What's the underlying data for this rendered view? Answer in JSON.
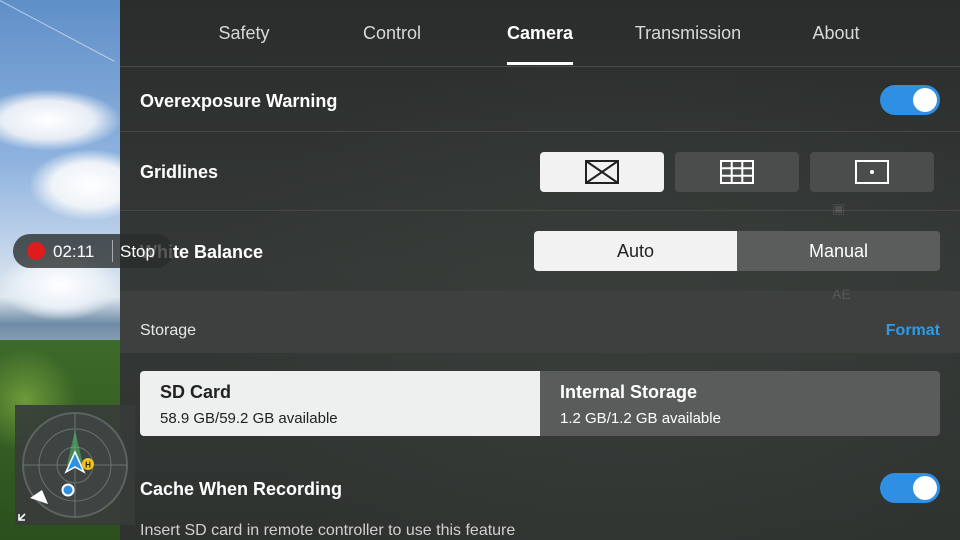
{
  "tabs": [
    {
      "label": "Safety"
    },
    {
      "label": "Control"
    },
    {
      "label": "Camera"
    },
    {
      "label": "Transmission"
    },
    {
      "label": "About"
    }
  ],
  "active_tab": "Camera",
  "settings": {
    "overexposure": {
      "label": "Overexposure Warning",
      "enabled": true
    },
    "gridlines": {
      "label": "Gridlines",
      "options": [
        "diagonal-grid-icon",
        "thirds-grid-icon",
        "center-point-icon"
      ],
      "selected": "diagonal-grid-icon"
    },
    "white_balance": {
      "label": "White Balance",
      "options": [
        "Auto",
        "Manual"
      ],
      "selected": "Auto"
    },
    "cache_recording": {
      "label": "Cache When Recording",
      "enabled": true
    }
  },
  "storage": {
    "section_title": "Storage",
    "format_label": "Format",
    "options": [
      {
        "name": "SD Card",
        "availability": "58.9 GB/59.2 GB available"
      },
      {
        "name": "Internal Storage",
        "availability": "1.2 GB/1.2 GB available"
      }
    ],
    "selected": "SD Card"
  },
  "hint": "Insert SD card in remote controller to use this feature",
  "recording": {
    "time": "02:11",
    "stop_label": "Stop"
  },
  "colors": {
    "accent": "#2e8fe3",
    "record": "#e01b1b",
    "link": "#2e9be8"
  }
}
